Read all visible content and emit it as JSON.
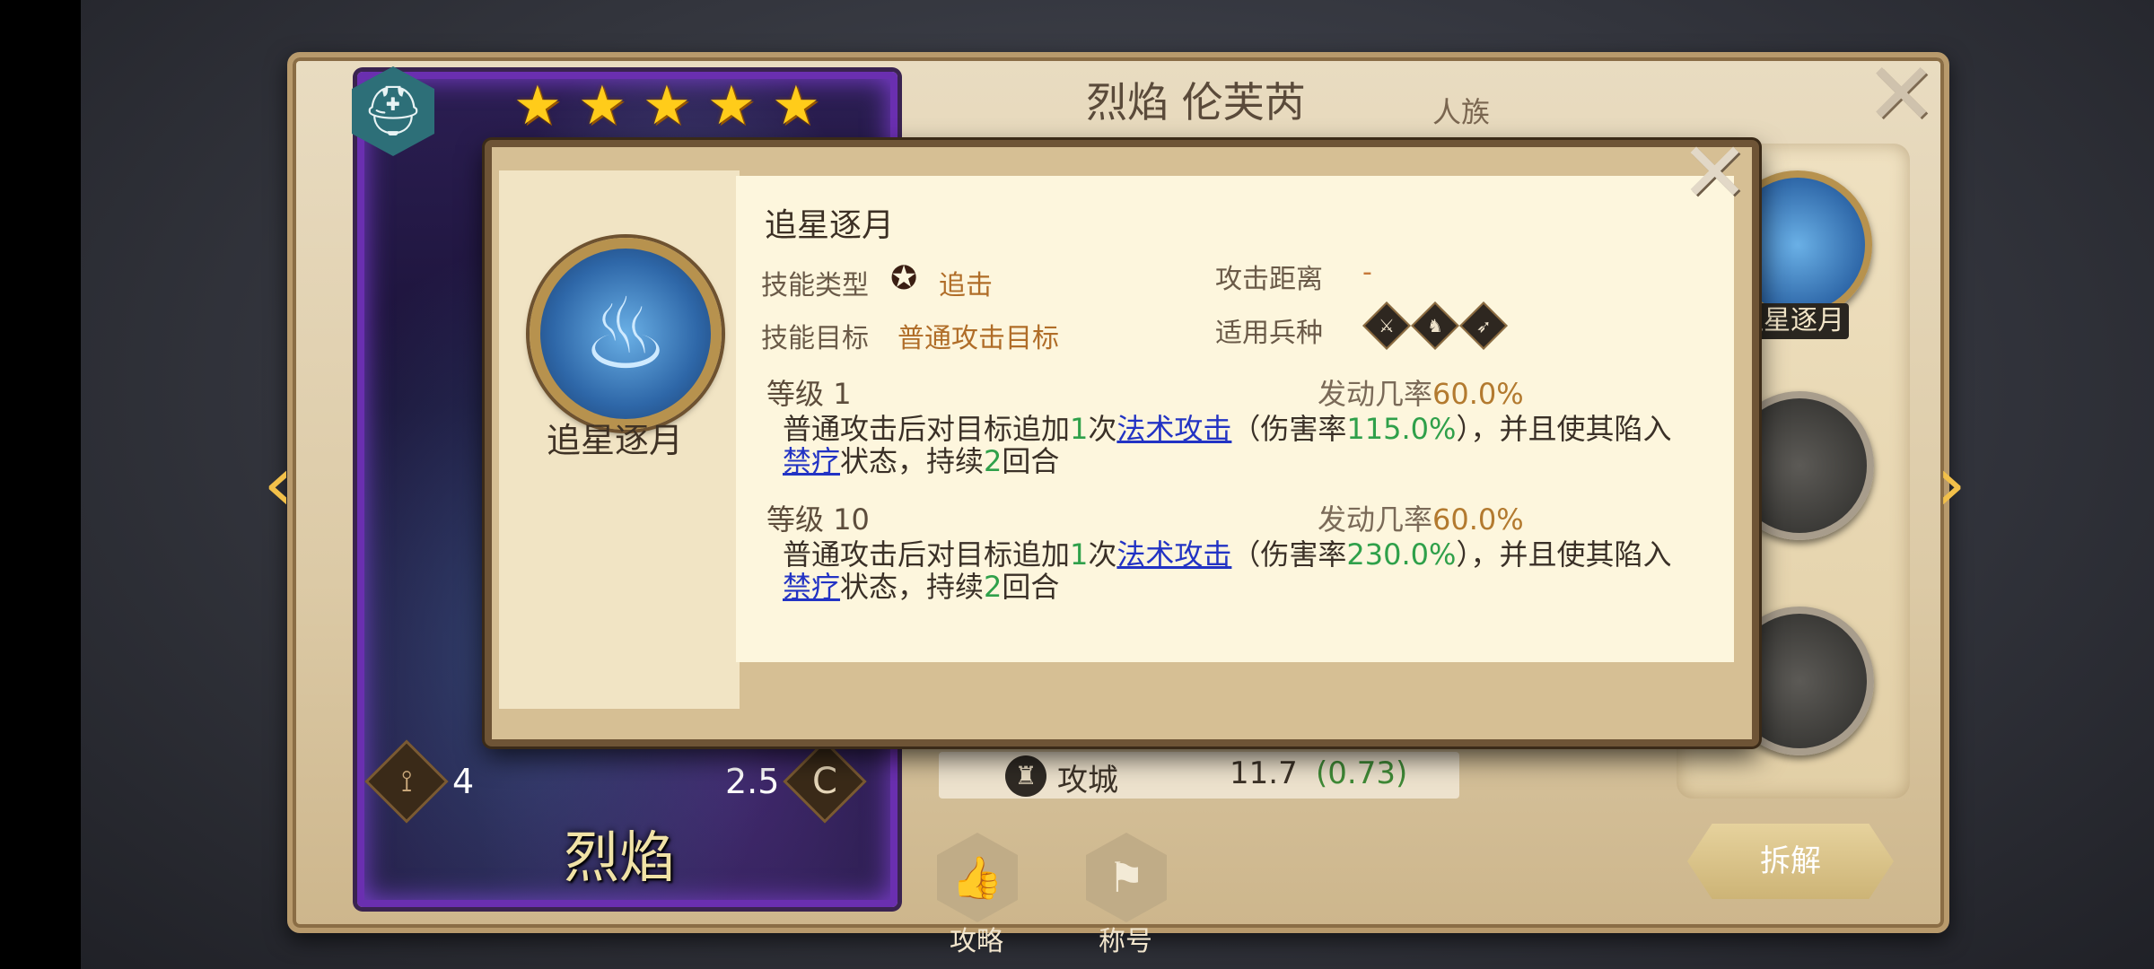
{
  "hero": {
    "name": "烈焰",
    "stars": 5,
    "stat_left": "4",
    "stat_right": "2.5",
    "stat_right_grade": "C"
  },
  "panel": {
    "title": "烈焰 伦芙芮",
    "race": "人族",
    "side_skill_label": "追星逐月",
    "disassemble_label": "拆解",
    "bottom_buttons": [
      {
        "label": "攻略"
      },
      {
        "label": "称号"
      }
    ],
    "siege_row": {
      "label": "攻城",
      "value": "11.7",
      "growth": "(0.73)"
    }
  },
  "popup": {
    "skill_name_left": "追星逐月",
    "title": "追星逐月",
    "skill_type_label": "技能类型",
    "skill_type_value": "追击",
    "attack_range_label": "攻击距离",
    "attack_range_value": "-",
    "skill_target_label": "技能目标",
    "skill_target_value": "普通攻击目标",
    "unit_types_label": "适用兵种",
    "levels": [
      {
        "level_label": "等级",
        "level_num": "1",
        "rate_label": "发动几率",
        "rate_value": "60.0%",
        "desc": {
          "p1": "普通攻击后对目标追加",
          "n1": "1",
          "p2": "次",
          "link1": "法术攻击",
          "p3": "（伤害率",
          "n2": "115.0%",
          "p4": "），并且使其陷入",
          "link2": "禁疗",
          "p5": "状态，持续",
          "n3": "2",
          "p6": "回合"
        }
      },
      {
        "level_label": "等级",
        "level_num": "10",
        "rate_label": "发动几率",
        "rate_value": "60.0%",
        "desc": {
          "p1": "普通攻击后对目标追加",
          "n1": "1",
          "p2": "次",
          "link1": "法术攻击",
          "p3": "（伤害率",
          "n2": "230.0%",
          "p4": "），并且使其陷入",
          "link2": "禁疗",
          "p5": "状态，持续",
          "n3": "2",
          "p6": "回合"
        }
      }
    ]
  },
  "icons": {
    "helm": "helmet-icon",
    "close": "close-icon",
    "arrow_left": "chevron-left-icon",
    "arrow_right": "chevron-right-icon",
    "thumb": "thumbs-up-icon",
    "flag": "flag-icon",
    "skill": "blue-flame-icon"
  },
  "colors": {
    "card_border": "#6a2fb0",
    "green_value": "#2fa04a",
    "link_blue": "#2233c4",
    "orange_value": "#b06d28",
    "star": "#ffcc1a"
  }
}
